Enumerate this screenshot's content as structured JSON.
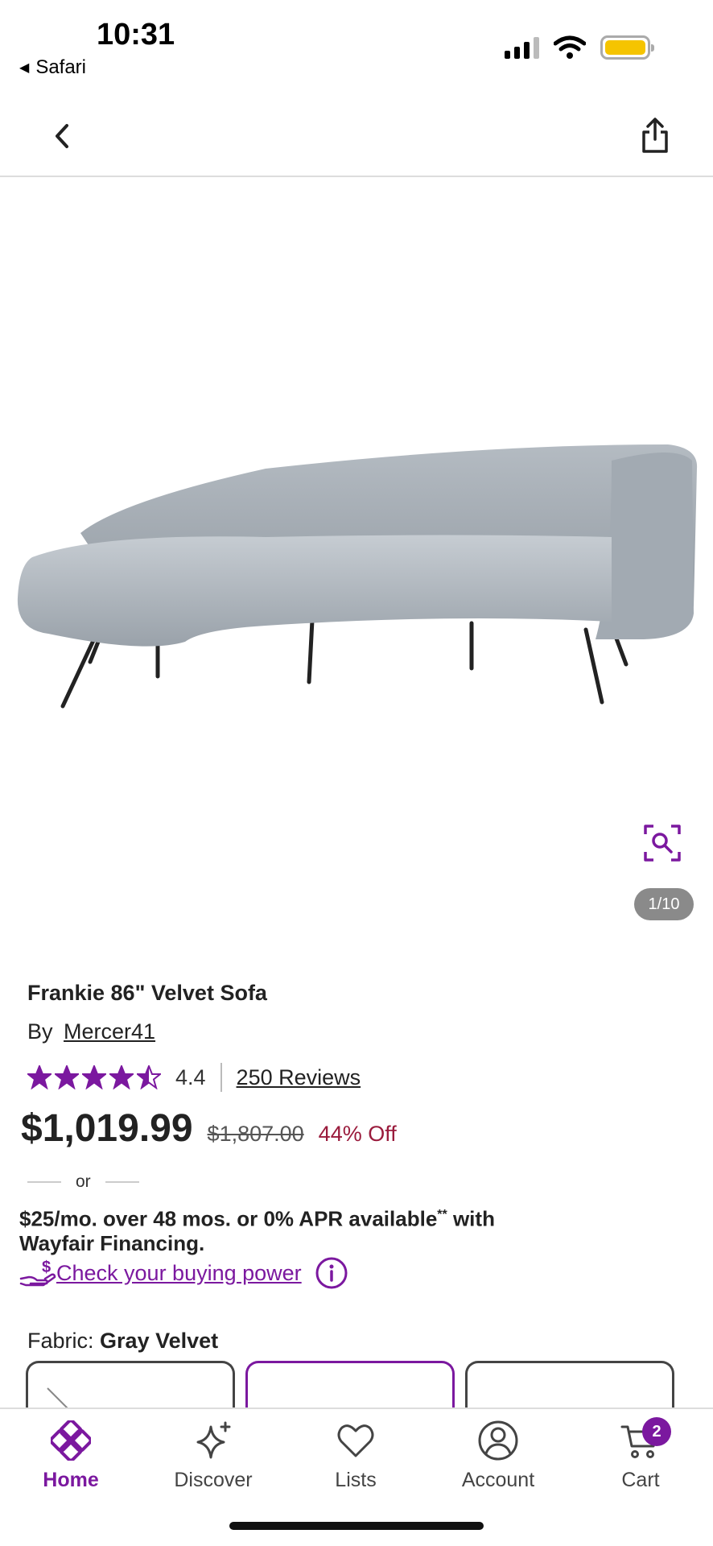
{
  "status_bar": {
    "time": "10:31",
    "back_app": "Safari",
    "battery_color": "#f5c400"
  },
  "nav": {
    "back_icon": "chevron-left-icon",
    "share_icon": "share-icon"
  },
  "gallery": {
    "counter": "1/10",
    "zoom_icon": "zoom-search-icon"
  },
  "product": {
    "title": "Frankie 86\" Velvet Sofa",
    "by_label": "By",
    "brand": "Mercer41",
    "rating": "4.4",
    "rating_value": 4.4,
    "rating_max": 5,
    "reviews_label": "250 Reviews",
    "price": "$1,019.99",
    "was_price": "$1,807.00",
    "discount": "44% Off"
  },
  "financing": {
    "or_label": "or",
    "text_part1": "$25/mo. over 48 mos. or 0% APR available",
    "footnote": "**",
    "text_part2": " with Wayfair Financing.",
    "buying_power_link": "Check your buying power",
    "info_icon": "info-icon"
  },
  "fabric": {
    "label": "Fabric:",
    "value": "Gray Velvet",
    "selected_index": 1
  },
  "tabbar": {
    "tabs": [
      {
        "label": "Home",
        "icon": "home-icon",
        "active": true
      },
      {
        "label": "Discover",
        "icon": "sparkle-icon",
        "active": false
      },
      {
        "label": "Lists",
        "icon": "heart-icon",
        "active": false
      },
      {
        "label": "Account",
        "icon": "account-icon",
        "active": false
      },
      {
        "label": "Cart",
        "icon": "cart-icon",
        "active": false
      }
    ],
    "cart_count": "2"
  },
  "colors": {
    "accent": "#7b189f",
    "discount": "#9a1b3c"
  }
}
